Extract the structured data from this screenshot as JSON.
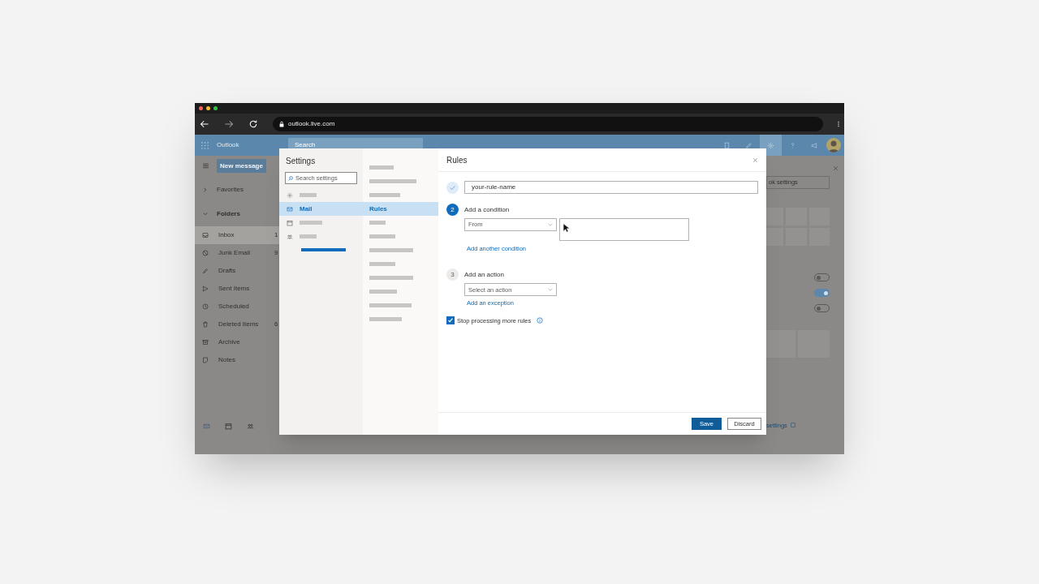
{
  "browser": {
    "url": "outlook.live.com"
  },
  "outlook": {
    "app_name": "Outlook",
    "search_placeholder": "Search",
    "new_message": "New message",
    "nav": [
      {
        "kind": "header",
        "label": "Favorites",
        "expanded": false
      },
      {
        "kind": "header",
        "label": "Folders",
        "expanded": true
      },
      {
        "kind": "folder",
        "label": "Inbox",
        "count": "1",
        "selected": true
      },
      {
        "kind": "folder",
        "label": "Junk Email",
        "count": "9",
        "selected": false
      },
      {
        "kind": "folder",
        "label": "Drafts",
        "selected": false
      },
      {
        "kind": "folder",
        "label": "Sent Items",
        "selected": false
      },
      {
        "kind": "folder",
        "label": "Scheduled",
        "selected": false
      },
      {
        "kind": "folder",
        "label": "Deleted Items",
        "count": "6",
        "selected": false
      },
      {
        "kind": "folder",
        "label": "Archive",
        "selected": false
      },
      {
        "kind": "folder",
        "label": "Notes",
        "selected": false
      }
    ],
    "quick_settings": {
      "search_text": "ok settings",
      "toggles": [
        {
          "on": false
        },
        {
          "on": true
        },
        {
          "on": false
        }
      ],
      "link": "settings"
    }
  },
  "settings": {
    "title": "Settings",
    "search_placeholder": "Search settings",
    "categories": [
      {
        "selected": false
      },
      {
        "label": "Mail",
        "selected": true
      },
      {
        "selected": false
      },
      {
        "selected": false
      }
    ],
    "subcategories": [
      {
        "selected": false
      },
      {
        "selected": false
      },
      {
        "selected": false
      },
      {
        "label": "Rules",
        "selected": true
      },
      {
        "selected": false
      },
      {
        "selected": false
      },
      {
        "selected": false
      },
      {
        "selected": false
      },
      {
        "selected": false
      },
      {
        "selected": false
      },
      {
        "selected": false
      },
      {
        "selected": false
      }
    ]
  },
  "rules": {
    "title": "Rules",
    "name_step": {
      "completed": true,
      "value": "your-rule-name"
    },
    "condition_step": {
      "active": true,
      "number": "2",
      "title": "Add a condition",
      "select": "From",
      "link": "Add another condition"
    },
    "action_step": {
      "active": false,
      "number": "3",
      "title": "Add an action",
      "select_placeholder": "Select an action",
      "link": "Add an exception"
    },
    "stop_processing": {
      "label": "Stop processing more rules",
      "checked": true
    },
    "buttons": [
      {
        "kind": "primary",
        "label": "Save"
      },
      {
        "kind": "secondary",
        "label": "Discard"
      }
    ]
  }
}
